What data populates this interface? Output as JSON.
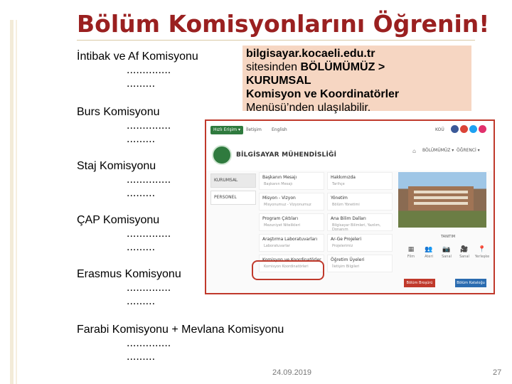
{
  "slide": {
    "title": "Bölüm Komisyonlarını Öğrenin!",
    "dots_a": "..............",
    "dots_b": ".........",
    "items": [
      "İntibak ve Af Komisyonu",
      "Burs Komisyonu",
      "Staj Komisyonu",
      "ÇAP Komisyonu",
      "Erasmus Komisyonu",
      "Farabi Komisyonu  + Mevlana Komisyonu"
    ],
    "callout": {
      "line1": "bilgisayar.kocaeli.edu.tr",
      "line2_plain": "sitesinden ",
      "line2_bold": "BÖLÜMÜMÜZ >",
      "line3": "KURUMSAL",
      "line4": "Komisyon ve Koordinatörler",
      "line5": "Menüsü’nden ulaşılabilir."
    },
    "footer": {
      "date": "24.09.2019",
      "page": "27"
    }
  },
  "screenshot": {
    "nav_left": [
      "Hızlı Erişim ▾",
      "İletişim",
      "English"
    ],
    "nav_right": "KOÜ",
    "brand": "BİLGİSAYAR MÜHENDİSLİĞİ",
    "top_menu": [
      "BÖLÜMÜMÜZ ▾",
      "ÖĞRENCİ ▾"
    ],
    "side_menu": [
      "KURUMSAL",
      "PERSONEL"
    ],
    "cells": [
      {
        "h": "Başkanın Mesajı",
        "s": "Başkanın Mesajı"
      },
      {
        "h": "Hakkımızda",
        "s": "Tarihçe"
      },
      {
        "h": "Misyon - Vizyon",
        "s": "Misyonumuz - Vizyonumuz"
      },
      {
        "h": "Yönetim",
        "s": "Bölüm Yönetimi"
      },
      {
        "h": "Program Çıktıları",
        "s": "Mezuniyet Nitelikleri"
      },
      {
        "h": "Ana Bilim Dalları",
        "s": "Bilgisayar Bilimleri, Yazılım, Donanım"
      },
      {
        "h": "Araştırma Laboratuvarları",
        "s": "Laboratuvarlar"
      },
      {
        "h": "Ar-Ge Projeleri",
        "s": "Projelerimiz"
      },
      {
        "h": "Komisyon ve Koordinatörler",
        "s": "Komisyon Koordinatörleri"
      },
      {
        "h": "Öğretim Üyeleri",
        "s": "İletişim Bilgileri"
      }
    ],
    "tanit": "TANITIM",
    "icons": [
      {
        "glyph": "▦",
        "label": "Film"
      },
      {
        "glyph": "👥",
        "label": "Ateri"
      },
      {
        "glyph": "📷",
        "label": "Sanal"
      },
      {
        "glyph": "🎥",
        "label": "Sanal"
      },
      {
        "glyph": "📍",
        "label": "Yerleşke"
      }
    ],
    "buttons": [
      "Bölüm Broşürü",
      "Bölüm Kataloğu"
    ],
    "colors": {
      "accent_red": "#c0392b",
      "title_red": "#9a2020",
      "callout_bg": "#f6d6c2",
      "nav_green": "#2f7a3e"
    }
  }
}
